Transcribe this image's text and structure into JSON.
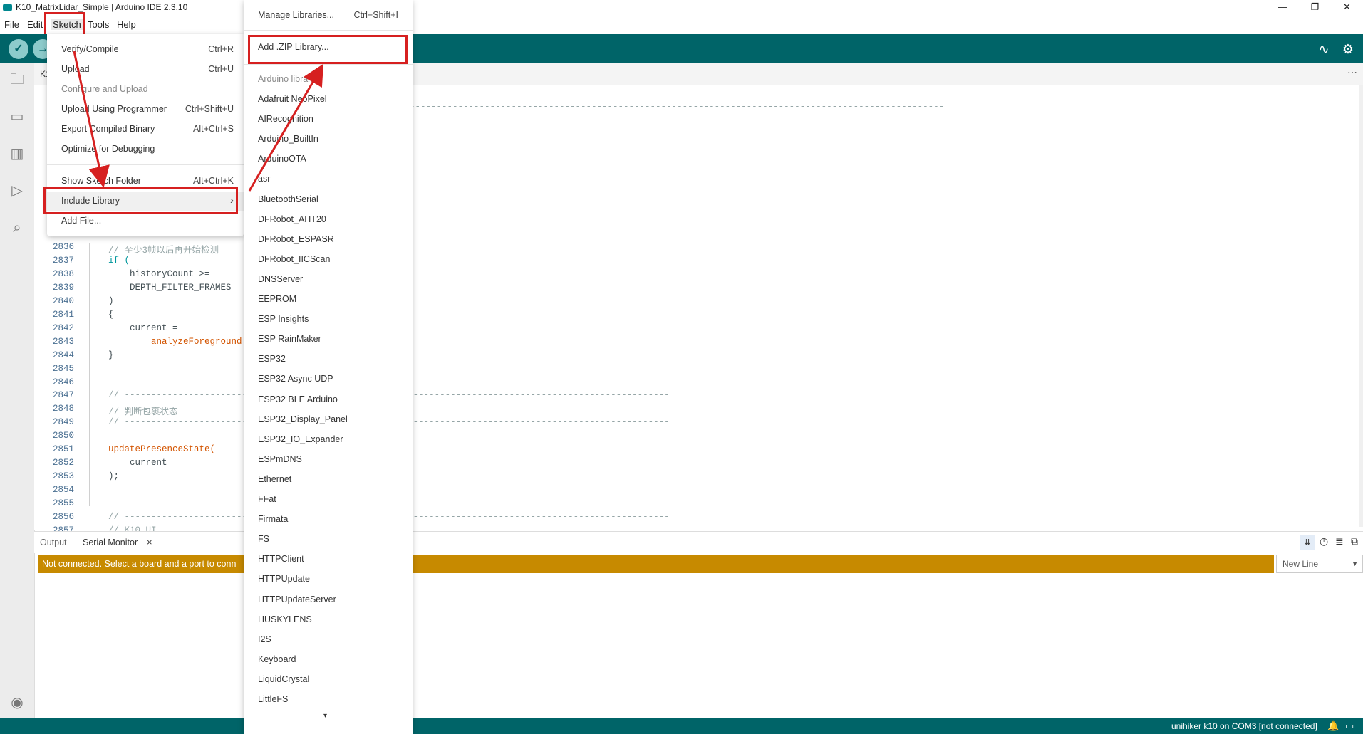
{
  "window": {
    "title": "K10_MatrixLidar_Simple | Arduino IDE 2.3.10",
    "minimize": "—",
    "maximize": "❐",
    "close": "✕"
  },
  "menubar": {
    "file": "File",
    "edit": "Edit",
    "sketch": "Sketch",
    "tools": "Tools",
    "help": "Help"
  },
  "toolbar": {
    "verify_icon": "check-icon",
    "upload_icon": "arrow-right-icon",
    "tab_label": "K10"
  },
  "sketch_menu": {
    "items": [
      {
        "label": "Verify/Compile",
        "shortcut": "Ctrl+R"
      },
      {
        "label": "Upload",
        "shortcut": "Ctrl+U"
      },
      {
        "label": "Configure and Upload",
        "shortcut": ""
      },
      {
        "label": "Upload Using Programmer",
        "shortcut": "Ctrl+Shift+U"
      },
      {
        "label": "Export Compiled Binary",
        "shortcut": "Alt+Ctrl+S"
      },
      {
        "label": "Optimize for Debugging",
        "shortcut": ""
      },
      {
        "label": "Show Sketch Folder",
        "shortcut": "Alt+Ctrl+K"
      },
      {
        "label": "Include Library",
        "shortcut": "›"
      },
      {
        "label": "Add File...",
        "shortcut": ""
      }
    ]
  },
  "library_submenu": {
    "manage": {
      "label": "Manage Libraries...",
      "shortcut": "Ctrl+Shift+I"
    },
    "add_zip": "Add .ZIP Library...",
    "header": "Arduino libraries",
    "libraries": [
      "Adafruit NeoPixel",
      "AIRecognition",
      "Arduino_BuiltIn",
      "ArduinoOTA",
      "asr",
      "BluetoothSerial",
      "DFRobot_AHT20",
      "DFRobot_ESPASR",
      "DFRobot_IICScan",
      "DNSServer",
      "EEPROM",
      "ESP Insights",
      "ESP RainMaker",
      "ESP32",
      "ESP32 Async UDP",
      "ESP32 BLE Arduino",
      "ESP32_Display_Panel",
      "ESP32_IO_Expander",
      "ESPmDNS",
      "Ethernet",
      "FFat",
      "Firmata",
      "FS",
      "HTTPClient",
      "HTTPUpdate",
      "HTTPUpdateServer",
      "HUSKYLENS",
      "I2S",
      "Keyboard",
      "LiquidCrystal",
      "LittleFS"
    ],
    "more_indicator": "▾"
  },
  "editor": {
    "lines": [
      {
        "n": "2836",
        "code": "    // 至少3帧以后再开始检测"
      },
      {
        "n": "2837",
        "code": "    if ("
      },
      {
        "n": "2838",
        "code": "        historyCount >="
      },
      {
        "n": "2839",
        "code": "        DEPTH_FILTER_FRAMES"
      },
      {
        "n": "2840",
        "code": "    )"
      },
      {
        "n": "2841",
        "code": "    {"
      },
      {
        "n": "2842",
        "code": "        current ="
      },
      {
        "n": "2843",
        "code": "            analyzeForeground"
      },
      {
        "n": "2844",
        "code": "    }"
      },
      {
        "n": "2845",
        "code": ""
      },
      {
        "n": "2846",
        "code": ""
      },
      {
        "n": "2847",
        "code": "    // ------------------------------------------------------------------------------------------------------"
      },
      {
        "n": "2848",
        "code": "    // 判断包裹状态"
      },
      {
        "n": "2849",
        "code": "    // ------------------------------------------------------------------------------------------------------"
      },
      {
        "n": "2850",
        "code": ""
      },
      {
        "n": "2851",
        "code": "    updatePresenceState("
      },
      {
        "n": "2852",
        "code": "        current"
      },
      {
        "n": "2853",
        "code": "    );"
      },
      {
        "n": "2854",
        "code": ""
      },
      {
        "n": "2855",
        "code": ""
      },
      {
        "n": "2856",
        "code": "    // ------------------------------------------------------------------------------------------------------"
      },
      {
        "n": "2857",
        "code": "    // K10 UI"
      }
    ],
    "top_dashes": "------------------------------------------------------------------------------------------------------"
  },
  "bottom_panel": {
    "tab_output": "Output",
    "tab_serial": "Serial Monitor",
    "tab_close": "×",
    "not_connected": "Not connected. Select a board and a port to conn",
    "line_ending": "New Line"
  },
  "status_bar": {
    "board": "unihiker k10 on COM3 [not connected]"
  },
  "colors": {
    "teal": "#006468",
    "warning": "#c78a00",
    "highlight": "#d62020"
  }
}
